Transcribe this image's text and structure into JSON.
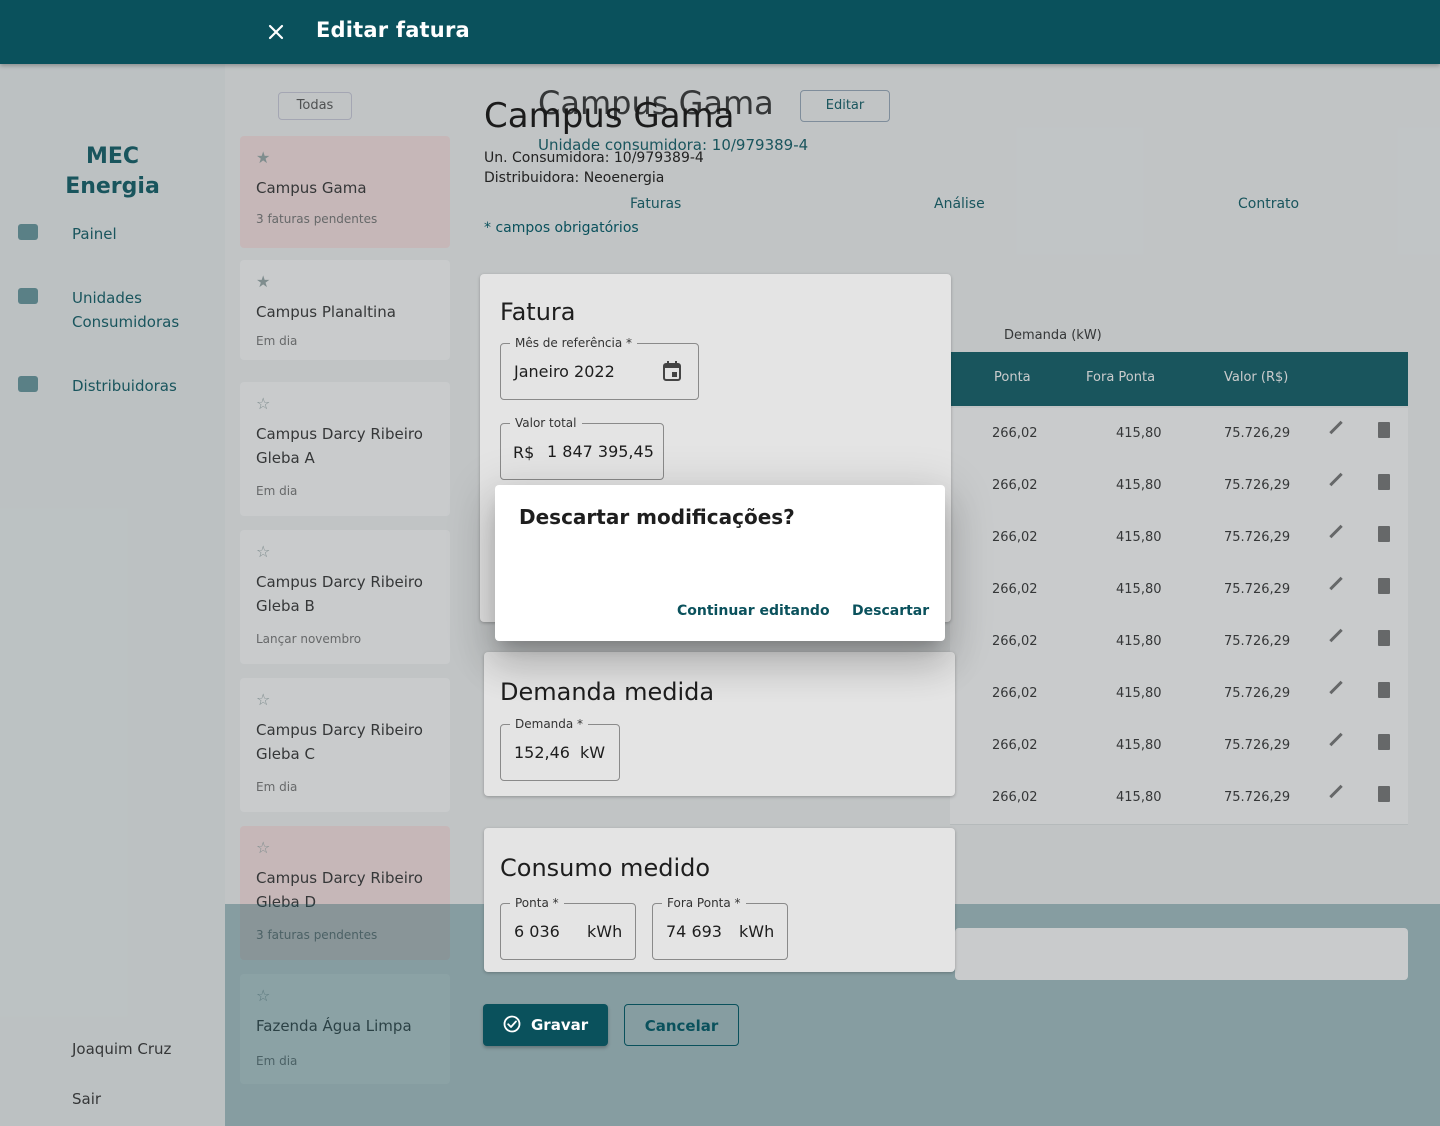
{
  "appbar": {
    "title": "Editar fatura"
  },
  "background": {
    "brand": [
      "MEC",
      "Energia"
    ],
    "nav": [
      "Painel",
      "Unidades Consumidoras",
      "Distribuidoras"
    ],
    "user": "Joaquim Cruz",
    "logout": "Sair",
    "filter": "Todas",
    "units": [
      {
        "name": "Campus Gama",
        "status": "3 faturas pendentes",
        "pending": true
      },
      {
        "name": "Campus Planaltina",
        "status": "Em dia",
        "pending": false
      },
      {
        "name": "Campus Darcy Ribeiro Gleba A",
        "status": "Em dia",
        "pending": false
      },
      {
        "name": "Campus Darcy Ribeiro Gleba B",
        "status": "Lançar novembro",
        "pending": false
      },
      {
        "name": "Campus Darcy Ribeiro Gleba C",
        "status": "Em dia",
        "pending": false
      },
      {
        "name": "Campus Darcy Ribeiro Gleba D",
        "status": "3 faturas pendentes",
        "pending": true
      },
      {
        "name": "Fazenda Água Limpa",
        "status": "Em dia",
        "pending": false
      }
    ],
    "page_title": "Campus Gama",
    "edit_label": "Editar",
    "unit_line": "Unidade consumidora: 10/979389-4",
    "tabs": [
      "Faturas",
      "Análise",
      "Contrato"
    ],
    "group_header": "Demanda (kW)",
    "columns": [
      "Ponta",
      "Fora Ponta",
      "Valor (R$)"
    ],
    "rows": [
      [
        "266,02",
        "415,80",
        "75.726,29"
      ],
      [
        "266,02",
        "415,80",
        "75.726,29"
      ],
      [
        "266,02",
        "415,80",
        "75.726,29"
      ],
      [
        "266,02",
        "415,80",
        "75.726,29"
      ],
      [
        "266,02",
        "415,80",
        "75.726,29"
      ],
      [
        "266,02",
        "415,80",
        "75.726,29"
      ],
      [
        "266,02",
        "415,80",
        "75.726,29"
      ],
      [
        "266,02",
        "415,80",
        "75.726,29"
      ]
    ]
  },
  "editor": {
    "unit_name": "Campus Gama",
    "consumer_unit": "Un. Consumidora: 10/979389-4",
    "distributor": "Distribuidora: Neoenergia",
    "required_note": "* campos obrigatórios",
    "invoice": {
      "title": "Fatura",
      "month_label": "Mês de referência *",
      "month_value": "Janeiro 2022",
      "total_label": "Valor total",
      "total_prefix": "R$",
      "total_value": "1 847 395,45"
    },
    "demand": {
      "title": "Demanda medida",
      "label": "Demanda *",
      "value": "152,46",
      "unit": "kW"
    },
    "consumption": {
      "title": "Consumo medido",
      "peak_label": "Ponta *",
      "peak_value": "6 036",
      "peak_unit": "kWh",
      "offpeak_label": "Fora Ponta *",
      "offpeak_value": "74 693",
      "offpeak_unit": "kWh"
    },
    "save_label": "Gravar",
    "cancel_label": "Cancelar"
  },
  "confirm_dialog": {
    "title": "Descartar modificações?",
    "continue_label": "Continuar editando",
    "discard_label": "Descartar"
  },
  "colors": {
    "primary": "#0a515c",
    "pending_card": "#fbe3e3"
  }
}
